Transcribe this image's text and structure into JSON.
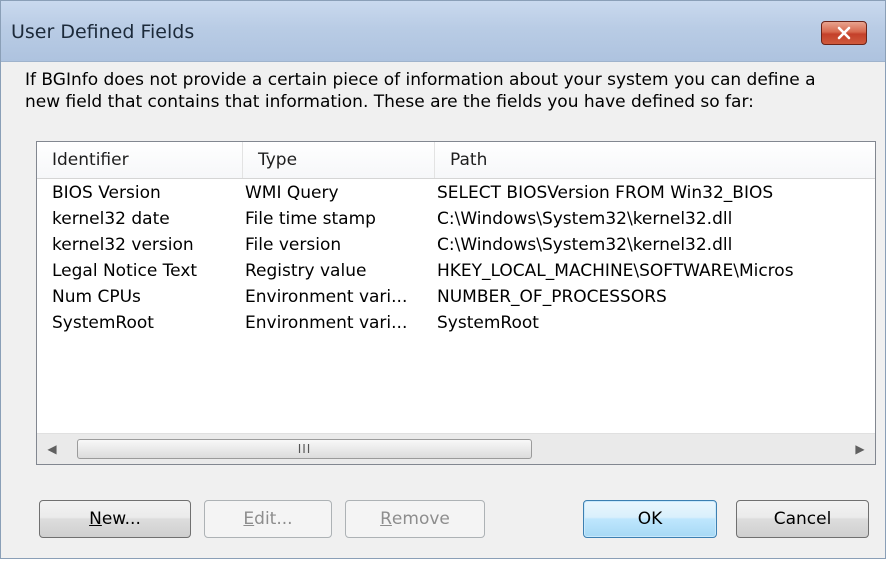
{
  "window": {
    "title": "User Defined Fields"
  },
  "description": {
    "line1": "If BGInfo does not provide a certain piece of information about your system you can define a",
    "line2": "new field that contains that information. These are the fields you have defined so far:"
  },
  "list": {
    "columns": [
      "Identifier",
      "Type",
      "Path"
    ],
    "rows": [
      {
        "identifier": "BIOS Version",
        "type": "WMI Query",
        "path": "SELECT BIOSVersion FROM Win32_BIOS"
      },
      {
        "identifier": "kernel32 date",
        "type": "File time stamp",
        "path": "C:\\Windows\\System32\\kernel32.dll"
      },
      {
        "identifier": "kernel32 version",
        "type": "File version",
        "path": "C:\\Windows\\System32\\kernel32.dll"
      },
      {
        "identifier": "Legal Notice Text",
        "type": "Registry value",
        "path": "HKEY_LOCAL_MACHINE\\SOFTWARE\\Micros"
      },
      {
        "identifier": "Num CPUs",
        "type": "Environment vari...",
        "path": "NUMBER_OF_PROCESSORS"
      },
      {
        "identifier": "SystemRoot",
        "type": "Environment vari...",
        "path": "SystemRoot"
      }
    ],
    "scroll_grip": "III",
    "scroll_left": "◀",
    "scroll_right": "▶"
  },
  "buttons": {
    "new_mnemonic": "N",
    "new_rest": "ew...",
    "edit_mnemonic": "E",
    "edit_rest": "dit...",
    "remove_mnemonic": "R",
    "remove_rest": "emove",
    "ok": "OK",
    "cancel": "Cancel"
  },
  "colors": {
    "titlebar": "#b9cce5",
    "close_button": "#c4402a",
    "default_button_border": "#3c7fb1"
  }
}
